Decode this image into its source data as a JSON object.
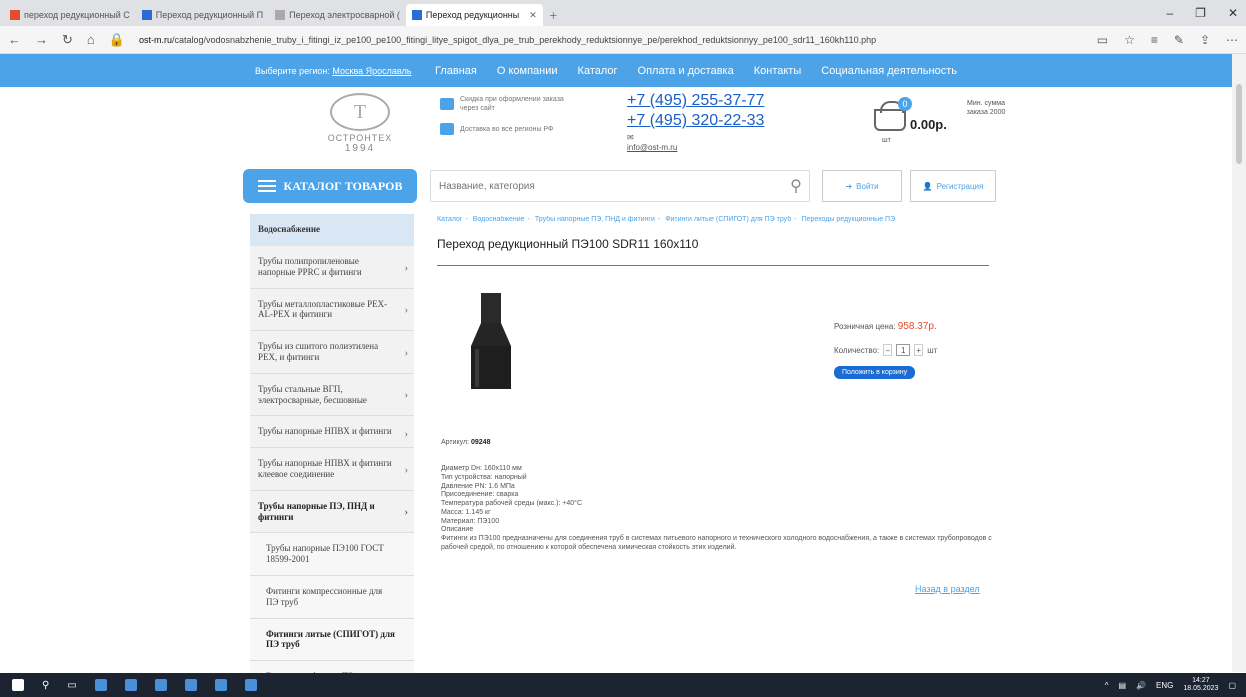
{
  "browser": {
    "tabs": [
      {
        "label": "переход редукционный С",
        "active": false
      },
      {
        "label": "Переход редукционный П",
        "active": false
      },
      {
        "label": "Переход электросварной (",
        "active": false
      },
      {
        "label": "Переход редукционны",
        "active": true
      }
    ],
    "url_domain": "ost-m.ru",
    "url_path": "/catalog/vodosnabzhenie_truby_i_fitingi_iz_pe100_pe100_fitingi_litye_spigot_dlya_pe_trub_perekhody_reduktsionnye_pe/perekhod_reduktsionnyy_pe100_sdr11_160kh110.php"
  },
  "topnav": {
    "region_label": "Выберите регион:",
    "region_value": "Москва Ярославль",
    "links": [
      "Главная",
      "О компании",
      "Каталог",
      "Оплата и доставка",
      "Контакты",
      "Социальная деятельность"
    ]
  },
  "header": {
    "logo_name": "ОСТРОНТЕХ",
    "logo_year": "1994",
    "info1": "Скидка при оформлении заказа через сайт",
    "info2": "Доставка во все регионы РФ",
    "phone1": "+7 (495) 255-37-77",
    "phone2": "+7 (495) 320-22-33",
    "email": "info@ost-m.ru",
    "cart_count": "0",
    "cart_total": "0.00р.",
    "cart_min": "Мин. сумма заказа 2000",
    "cart_pcs": "шт"
  },
  "toolbar": {
    "catalog_label": "КАТАЛОГ ТОВАРОВ",
    "search_placeholder": "Название, категория",
    "login_label": "Войти",
    "register_label": "Регистрация"
  },
  "sidebar": {
    "heading": "Водоснабжение",
    "items": [
      {
        "label": "Трубы полипропиленовые напорные PPRC и фитинги",
        "chev": true,
        "style": ""
      },
      {
        "label": "Трубы металлопластиковые PEX-AL-PEX и фитинги",
        "chev": true,
        "style": ""
      },
      {
        "label": "Трубы из сшитого полиэтилена PEX, и фитинги",
        "chev": true,
        "style": ""
      },
      {
        "label": "Трубы стальные ВГП, электросварные, бесшовные",
        "chev": true,
        "style": ""
      },
      {
        "label": "Трубы напорные НПВХ и фитинги",
        "chev": true,
        "style": ""
      },
      {
        "label": "Трубы напорные НПВХ и фитинги клеевое соединение",
        "chev": true,
        "style": ""
      },
      {
        "label": "Трубы напорные ПЭ, ПНД и фитинги",
        "chev": true,
        "style": "bold"
      },
      {
        "label": "Трубы напорные ПЭ100 ГОСТ 18599-2001",
        "chev": false,
        "style": "sub"
      },
      {
        "label": "Фитинги компрессионные для ПЭ труб",
        "chev": false,
        "style": "sub"
      },
      {
        "label": "Фитинги литые (СПИГОТ) для ПЭ труб",
        "chev": false,
        "style": "sub bold"
      },
      {
        "label": "Втулки под фланец ПЭ",
        "chev": false,
        "style": "sub"
      }
    ]
  },
  "product": {
    "breadcrumb": [
      "Каталог",
      "Водоснабжение",
      "Трубы напорные ПЭ, ПНД и фитинги",
      "Фитинги литые (СПИГОТ) для ПЭ труб",
      "Переходы редукционные ПЭ"
    ],
    "title": "Переход редукционный ПЭ100 SDR11 160x110",
    "price_label": "Розничная цена:",
    "price_value": "958.37р.",
    "qty_label": "Количество:",
    "qty_value": "1",
    "qty_unit": "шт",
    "add_to_cart": "Положить в корзину",
    "article_label": "Артикул:",
    "article_value": "09248",
    "specs": [
      "Диаметр Dн: 160х110 мм",
      "Тип устройства: напорный",
      "Давление PN: 1.6 МПа",
      "Присоединение: сварка",
      "Температура рабочей среды (макс.): +40°С",
      "Масса: 1.145 кг",
      "Материал: ПЭ100",
      "Описание",
      "Фитинги из ПЭ100 предназначены для соединения труб в системах питьевого напорного и технического холодного водоснабжения, а также в системах трубопроводов с рабочей средой, по отношению к которой обеспечена химическая стойкость этих изделий."
    ],
    "back_link": "Назад в раздел"
  },
  "taskbar": {
    "lang": "ENG",
    "time": "14:27",
    "date": "18.05.2023"
  }
}
